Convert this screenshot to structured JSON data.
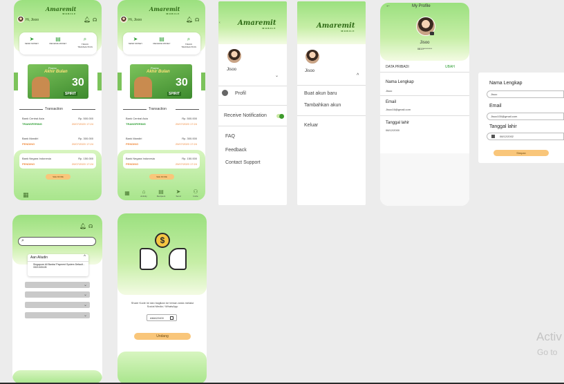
{
  "brand": {
    "name": "Amaremit",
    "sub": "MOBILE"
  },
  "home": {
    "greeting": "Hi, Jisoo",
    "actions": [
      {
        "label": "SEND MONEY",
        "icon": "send-icon"
      },
      {
        "label": "RECEIVE MONEY",
        "icon": "receive-icon"
      },
      {
        "label": "TRACK TRANSACTION",
        "icon": "track-icon"
      }
    ],
    "banner": {
      "line1": "Promo",
      "line2": "Akhir Bulan",
      "badge": "30",
      "tag": "SPIRIT"
    },
    "section_title": "Transaction",
    "transactions": [
      {
        "name": "Bank Central Asia",
        "amount": "Rp. 500.000",
        "status": "TRANSFERING",
        "date": "20/07/2020 17:24"
      },
      {
        "name": "Bank Mandiri",
        "amount": "Rp. 300.000",
        "status": "PENDING",
        "date": "20/07/2020 17:24"
      },
      {
        "name": "Bank Negara Indonesia",
        "amount": "Rp. 150.000",
        "status": "PENDING",
        "date": "20/07/2020 17:24"
      }
    ],
    "see_more": "SEE MORE",
    "nav": [
      {
        "label": "",
        "icon": "grid-icon"
      },
      {
        "label": "Activity",
        "icon": "home-icon"
      },
      {
        "label": "Recipient",
        "icon": "recipient-icon"
      },
      {
        "label": "Send",
        "icon": "send-icon"
      },
      {
        "label": "Invite",
        "icon": "invite-icon"
      }
    ]
  },
  "menu": {
    "name": "Jisoo",
    "items": [
      "Profil",
      "Receive Notification",
      "FAQ",
      "Feedback",
      "Contact Support"
    ]
  },
  "account_menu": {
    "name": "Jisoo",
    "items": [
      "Buat akun baru",
      "Tambahkan akun",
      "Keluar"
    ]
  },
  "profile": {
    "title": "My Profile",
    "name": "Jisoo",
    "phone": "0819********",
    "section": "DATA PRIBADI",
    "edit": "UBAH",
    "fields": [
      {
        "label": "Nama Lengkap",
        "value": "Jisoo"
      },
      {
        "label": "Email",
        "value": "Jisoo16@gmail.com"
      },
      {
        "label": "Tanggal lahir",
        "value": "08/12/2000"
      }
    ]
  },
  "edit_form": {
    "fields": [
      {
        "label": "Nama Lengkap",
        "value": "Jisoo"
      },
      {
        "label": "Email",
        "value": "Jisoo100@gmail.com"
      },
      {
        "label": "Tanggal lahir",
        "value": "08/12/2002"
      }
    ],
    "save": "Simpan"
  },
  "recipient": {
    "selected_name": "Aan Aliudin",
    "detail": "Singapore All Banks/ Payment System Default - 3321343126"
  },
  "referral": {
    "text": "Share Kode ini dan bagikan ke teman anda melalui Social Media / WhatsApp",
    "code": "AMA22400",
    "button": "Undang"
  },
  "watermark": {
    "line1": "Activ",
    "line2": "Go to"
  },
  "colors": {
    "green": "#9be07f",
    "orange": "#f08a3c",
    "button": "#f9c67a",
    "dark_green": "#2f6b16"
  }
}
